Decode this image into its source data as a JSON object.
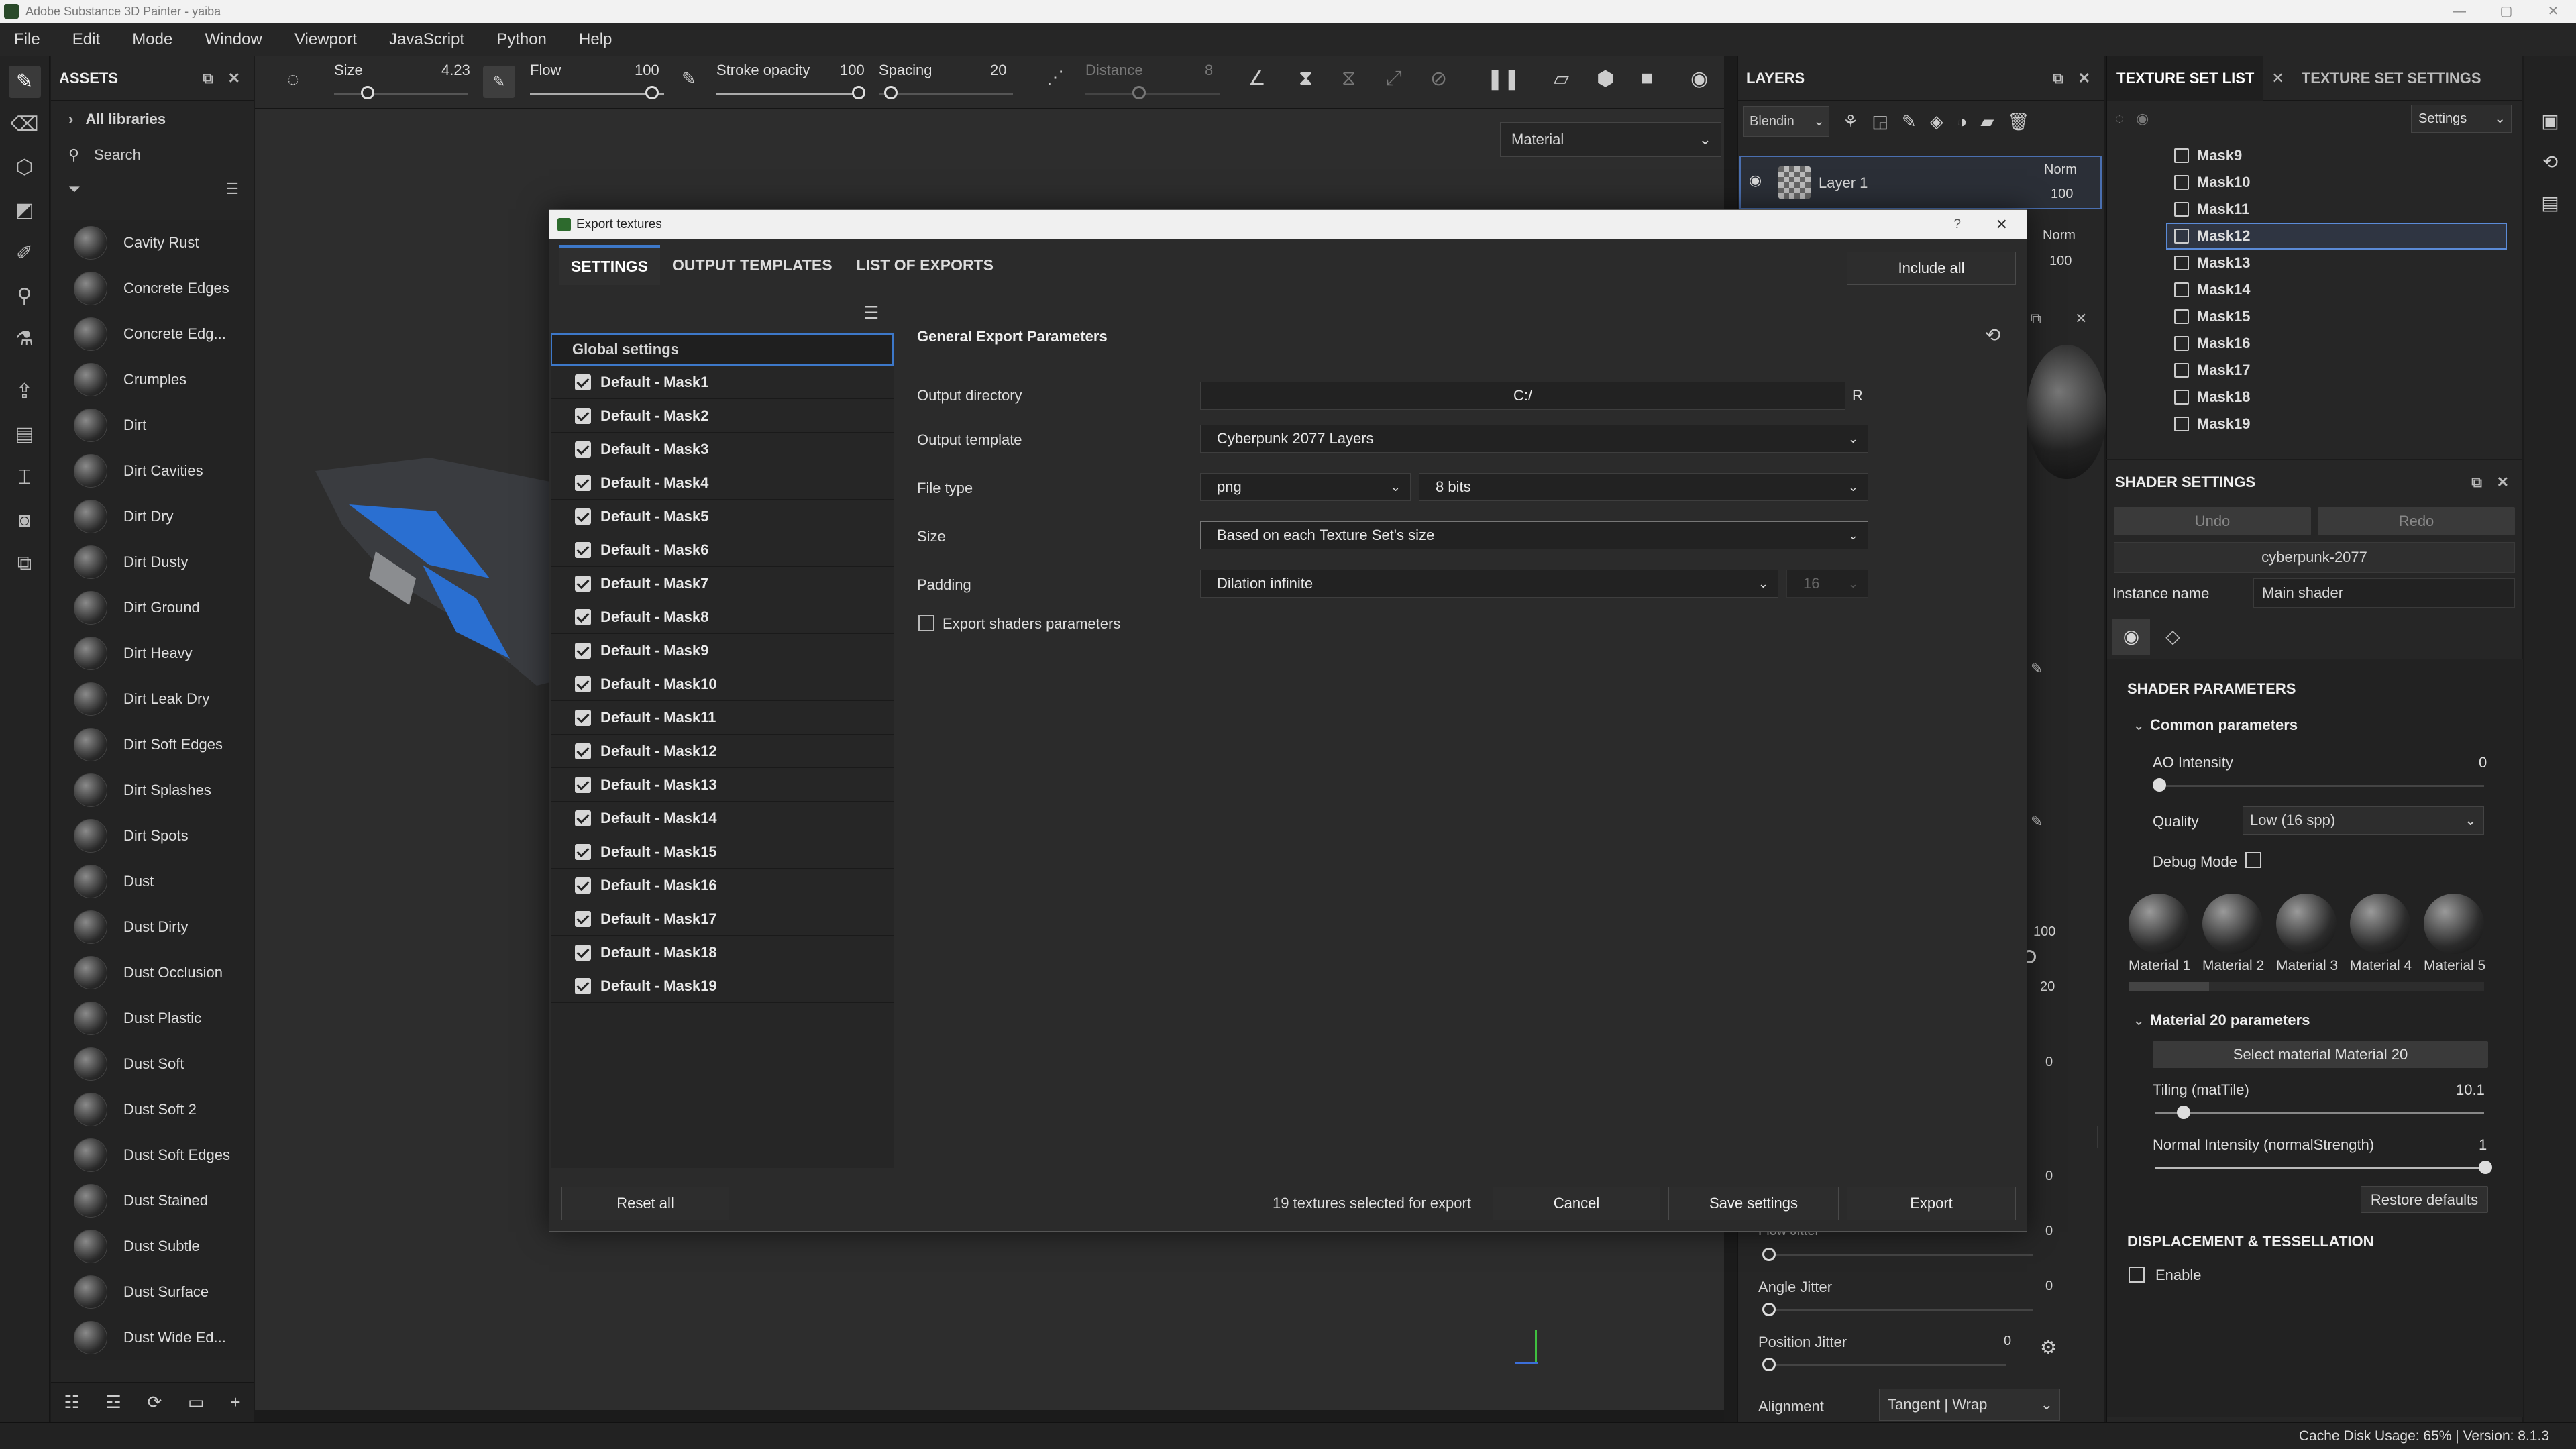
{
  "app": {
    "window_title": "Adobe Substance 3D Painter - yaiba"
  },
  "menu": [
    "File",
    "Edit",
    "Mode",
    "Window",
    "Viewport",
    "JavaScript",
    "Python",
    "Help"
  ],
  "assets": {
    "title": "ASSETS",
    "all_libraries": "All libraries",
    "search_placeholder": "Search",
    "items": [
      "Cavity Rust",
      "Concrete Edges",
      "Concrete Edg...",
      "Crumples",
      "Dirt",
      "Dirt Cavities",
      "Dirt Dry",
      "Dirt Dusty",
      "Dirt Ground",
      "Dirt Heavy",
      "Dirt Leak Dry",
      "Dirt Soft Edges",
      "Dirt Splashes",
      "Dirt Spots",
      "Dust",
      "Dust Dirty",
      "Dust Occlusion",
      "Dust Plastic",
      "Dust Soft",
      "Dust Soft 2",
      "Dust Soft Edges",
      "Dust Stained",
      "Dust Subtle",
      "Dust Surface",
      "Dust Wide Ed..."
    ]
  },
  "toolbar": {
    "size_label": "Size",
    "size_value": "4.23",
    "flow_label": "Flow",
    "flow_value": "100",
    "stroke_opacity_label": "Stroke opacity",
    "stroke_opacity_value": "100",
    "spacing_label": "Spacing",
    "spacing_value": "20",
    "distance_label": "Distance",
    "distance_value": "8"
  },
  "viewport": {
    "mode_select": "Material"
  },
  "layers": {
    "title": "LAYERS",
    "blending": "Blendin",
    "layer1_name": "Layer 1",
    "norm_label_1": "Norm",
    "opacity_1": "100",
    "norm_label_2": "Norm",
    "opacity_2": "100",
    "val_100": "100",
    "val_20": "20",
    "val_0a": "0",
    "val_0b": "0",
    "val_0c": "0",
    "flow_jitter": "Flow Jitter",
    "flow_jitter_value": "0",
    "angle_jitter": "Angle Jitter",
    "angle_jitter_value": "0",
    "position_jitter": "Position Jitter",
    "position_jitter_value": "0",
    "alignment_label": "Alignment",
    "alignment_value": "Tangent | Wrap"
  },
  "texture_set_list": {
    "tab1": "TEXTURE SET LIST",
    "tab2": "TEXTURE SET SETTINGS",
    "settings": "Settings",
    "items": [
      "Mask9",
      "Mask10",
      "Mask11",
      "Mask12",
      "Mask13",
      "Mask14",
      "Mask15",
      "Mask16",
      "Mask17",
      "Mask18",
      "Mask19"
    ],
    "selected": "Mask12"
  },
  "shader_settings": {
    "title": "SHADER SETTINGS",
    "undo": "Undo",
    "redo": "Redo",
    "shader_name": "cyberpunk-2077",
    "instance_label": "Instance name",
    "instance_value": "Main shader",
    "params_title": "SHADER PARAMETERS",
    "common_title": "Common parameters",
    "ao_label": "AO Intensity",
    "ao_value": "0",
    "quality_label": "Quality",
    "quality_value": "Low (16 spp)",
    "debug_label": "Debug Mode",
    "materials": [
      "Material 1",
      "Material 2",
      "Material 3",
      "Material 4",
      "Material 5"
    ],
    "mat20_title": "Material 20 parameters",
    "select_mat20": "Select material Material 20",
    "tiling_label": "Tiling (matTile)",
    "tiling_value": "10.1",
    "normal_label": "Normal Intensity (normalStrength)",
    "normal_value": "1",
    "restore": "Restore defaults",
    "disp_title": "DISPLACEMENT & TESSELLATION",
    "enable": "Enable"
  },
  "status": {
    "text": "Cache Disk Usage:   65% | Version: 8.1.3"
  },
  "export_dialog": {
    "title": "Export textures",
    "help": "?",
    "tabs": [
      "SETTINGS",
      "OUTPUT TEMPLATES",
      "LIST OF EXPORTS"
    ],
    "include_all": "Include all",
    "global_settings": "Global settings",
    "masks": [
      "Default - Mask1",
      "Default - Mask2",
      "Default - Mask3",
      "Default - Mask4",
      "Default - Mask5",
      "Default - Mask6",
      "Default - Mask7",
      "Default - Mask8",
      "Default - Mask9",
      "Default - Mask10",
      "Default - Mask11",
      "Default - Mask12",
      "Default - Mask13",
      "Default - Mask14",
      "Default - Mask15",
      "Default - Mask16",
      "Default - Mask17",
      "Default - Mask18",
      "Default - Mask19"
    ],
    "section_title": "General Export Parameters",
    "output_directory_label": "Output directory",
    "output_directory_value": "C:/",
    "output_directory_r": "R",
    "output_template_label": "Output template",
    "output_template_value": "Cyberpunk 2077 Layers",
    "file_type_label": "File type",
    "file_type_value": "png",
    "bit_depth_value": "8 bits",
    "size_label": "Size",
    "size_value": "Based on each Texture Set's size",
    "padding_label": "Padding",
    "padding_value": "Dilation infinite",
    "padding_px": "16",
    "export_shaders_label": "Export shaders parameters",
    "reset_all": "Reset all",
    "selected_count": "19 textures selected for export",
    "cancel": "Cancel",
    "save_settings": "Save settings",
    "export": "Export"
  }
}
